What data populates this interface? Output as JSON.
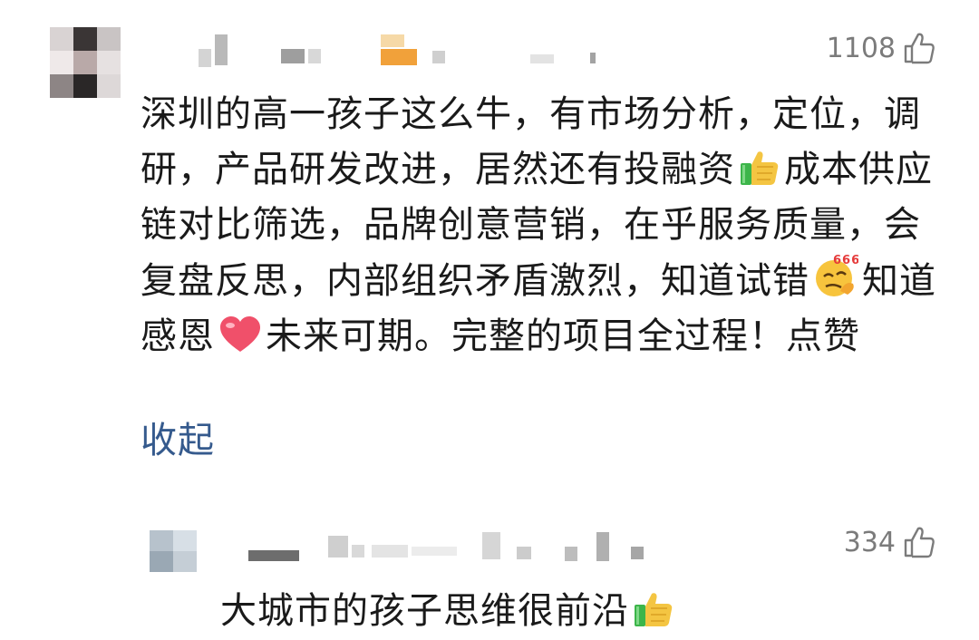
{
  "comments": [
    {
      "likes": "1108",
      "text_parts": [
        "深圳的高一孩子这么牛，有市场分析，定位，调研，产品研发改进，居然还有投融资",
        "成本供应链对比筛选，品牌创意营销，在乎服务质量，会复盘反思，内部组织矛盾激烈，知道试错",
        "知道感恩",
        "未来可期。完整的项目全过程！点赞"
      ],
      "emoji_label": "666",
      "collapse_label": "收起",
      "icons": [
        "thumbs-up-emoji",
        "666-smug-emoji",
        "heart-emoji"
      ]
    },
    {
      "likes": "334",
      "text": "大城市的孩子思维很前沿",
      "icons": [
        "thumbs-up-emoji"
      ]
    }
  ],
  "colors": {
    "text": "#1a1a1a",
    "likes": "#7b7b7b",
    "link": "#355a8d",
    "heart": "#f0506a",
    "thumb_yellow": "#f4c542",
    "thumb_green": "#3cb54a"
  }
}
